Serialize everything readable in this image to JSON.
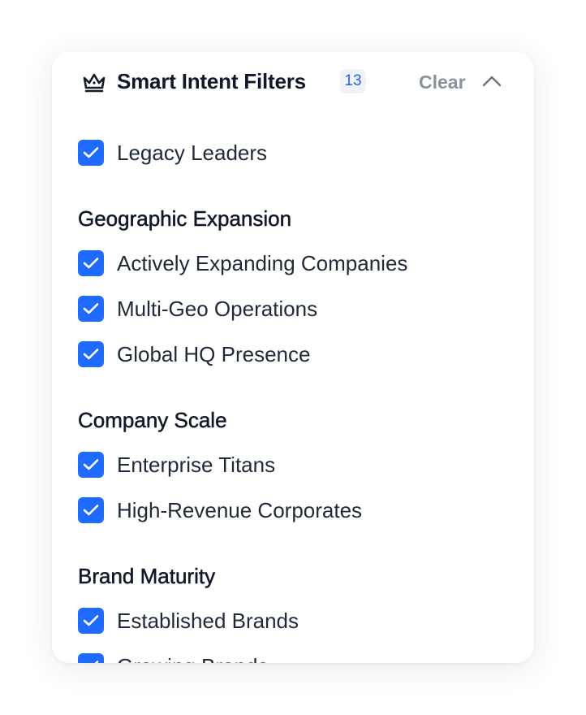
{
  "header": {
    "icon": "crown-icon",
    "title": "Smart Intent Filters",
    "count": "13",
    "clear_label": "Clear",
    "collapse_icon": "chevron-up-icon"
  },
  "colors": {
    "checkbox": "#1f6bff",
    "badge_text": "#2563eb",
    "muted": "#8a919e"
  },
  "filters": {
    "ungrouped": [
      {
        "label": "Legacy Leaders",
        "checked": true
      }
    ],
    "groups": [
      {
        "title": "Geographic Expansion",
        "items": [
          {
            "label": "Actively Expanding Companies",
            "checked": true
          },
          {
            "label": "Multi-Geo Operations",
            "checked": true
          },
          {
            "label": "Global HQ Presence",
            "checked": true
          }
        ]
      },
      {
        "title": "Company Scale",
        "items": [
          {
            "label": "Enterprise Titans",
            "checked": true
          },
          {
            "label": "High-Revenue Corporates",
            "checked": true
          }
        ]
      },
      {
        "title": "Brand Maturity",
        "items": [
          {
            "label": "Established Brands",
            "checked": true
          },
          {
            "label": "Growing Brands",
            "checked": true
          }
        ]
      }
    ]
  }
}
